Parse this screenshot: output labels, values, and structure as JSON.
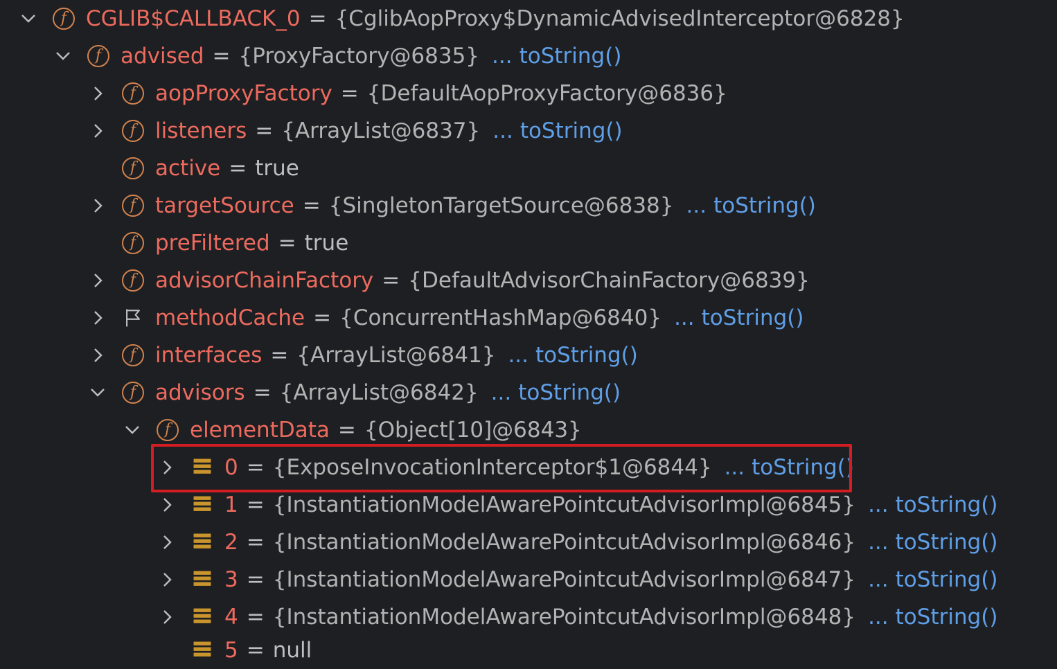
{
  "colors": {
    "background": "#1e1f22",
    "field_name": "#ed6a5e",
    "value": "#bcbec4",
    "link": "#5f9fe8",
    "field_icon": "#d2834f",
    "array_icon": "#c9952c",
    "highlight_border": "#d41d22"
  },
  "rows": [
    {
      "name": "CGLIB$CALLBACK_0",
      "eq": "=",
      "value": "{CglibAopProxy$DynamicAdvisedInterceptor@6828}",
      "tostring": "",
      "expand": "expanded",
      "icon": "field-icon"
    },
    {
      "name": "advised",
      "eq": "=",
      "value": "{ProxyFactory@6835}",
      "tostring": "toString()",
      "expand": "expanded",
      "icon": "field-icon"
    },
    {
      "name": "aopProxyFactory",
      "eq": "=",
      "value": "{DefaultAopProxyFactory@6836}",
      "tostring": "",
      "expand": "collapsed",
      "icon": "field-icon"
    },
    {
      "name": "listeners",
      "eq": "=",
      "value": "{ArrayList@6837}",
      "tostring": "toString()",
      "expand": "collapsed",
      "icon": "field-icon"
    },
    {
      "name": "active",
      "eq": "=",
      "value": "true",
      "tostring": "",
      "expand": "none",
      "icon": "field-icon"
    },
    {
      "name": "targetSource",
      "eq": "=",
      "value": "{SingletonTargetSource@6838}",
      "tostring": "toString()",
      "expand": "collapsed",
      "icon": "field-icon"
    },
    {
      "name": "preFiltered",
      "eq": "=",
      "value": "true",
      "tostring": "",
      "expand": "none",
      "icon": "field-icon"
    },
    {
      "name": "advisorChainFactory",
      "eq": "=",
      "value": "{DefaultAdvisorChainFactory@6839}",
      "tostring": "",
      "expand": "collapsed",
      "icon": "field-icon"
    },
    {
      "name": "methodCache",
      "eq": "=",
      "value": "{ConcurrentHashMap@6840}",
      "tostring": "toString()",
      "expand": "collapsed",
      "icon": "flag-icon"
    },
    {
      "name": "interfaces",
      "eq": "=",
      "value": "{ArrayList@6841}",
      "tostring": "toString()",
      "expand": "collapsed",
      "icon": "field-icon"
    },
    {
      "name": "advisors",
      "eq": "=",
      "value": "{ArrayList@6842}",
      "tostring": "toString()",
      "expand": "expanded",
      "icon": "field-icon"
    },
    {
      "name": "elementData",
      "eq": "=",
      "value": "{Object[10]@6843}",
      "tostring": "",
      "expand": "expanded",
      "icon": "field-icon"
    },
    {
      "name": "0",
      "eq": "=",
      "value": "{ExposeInvocationInterceptor$1@6844}",
      "tostring": "toString()",
      "expand": "collapsed",
      "icon": "array-element-icon"
    },
    {
      "name": "1",
      "eq": "=",
      "value": "{InstantiationModelAwarePointcutAdvisorImpl@6845}",
      "tostring": "toString()",
      "expand": "collapsed",
      "icon": "array-element-icon"
    },
    {
      "name": "2",
      "eq": "=",
      "value": "{InstantiationModelAwarePointcutAdvisorImpl@6846}",
      "tostring": "toString()",
      "expand": "collapsed",
      "icon": "array-element-icon"
    },
    {
      "name": "3",
      "eq": "=",
      "value": "{InstantiationModelAwarePointcutAdvisorImpl@6847}",
      "tostring": "toString()",
      "expand": "collapsed",
      "icon": "array-element-icon"
    },
    {
      "name": "4",
      "eq": "=",
      "value": "{InstantiationModelAwarePointcutAdvisorImpl@6848}",
      "tostring": "toString()",
      "expand": "collapsed",
      "icon": "array-element-icon"
    },
    {
      "name": "5",
      "eq": "=",
      "value": "null",
      "tostring": "",
      "expand": "none",
      "icon": "array-element-icon"
    }
  ],
  "ellipsis": "...",
  "highlighted_row": 0
}
